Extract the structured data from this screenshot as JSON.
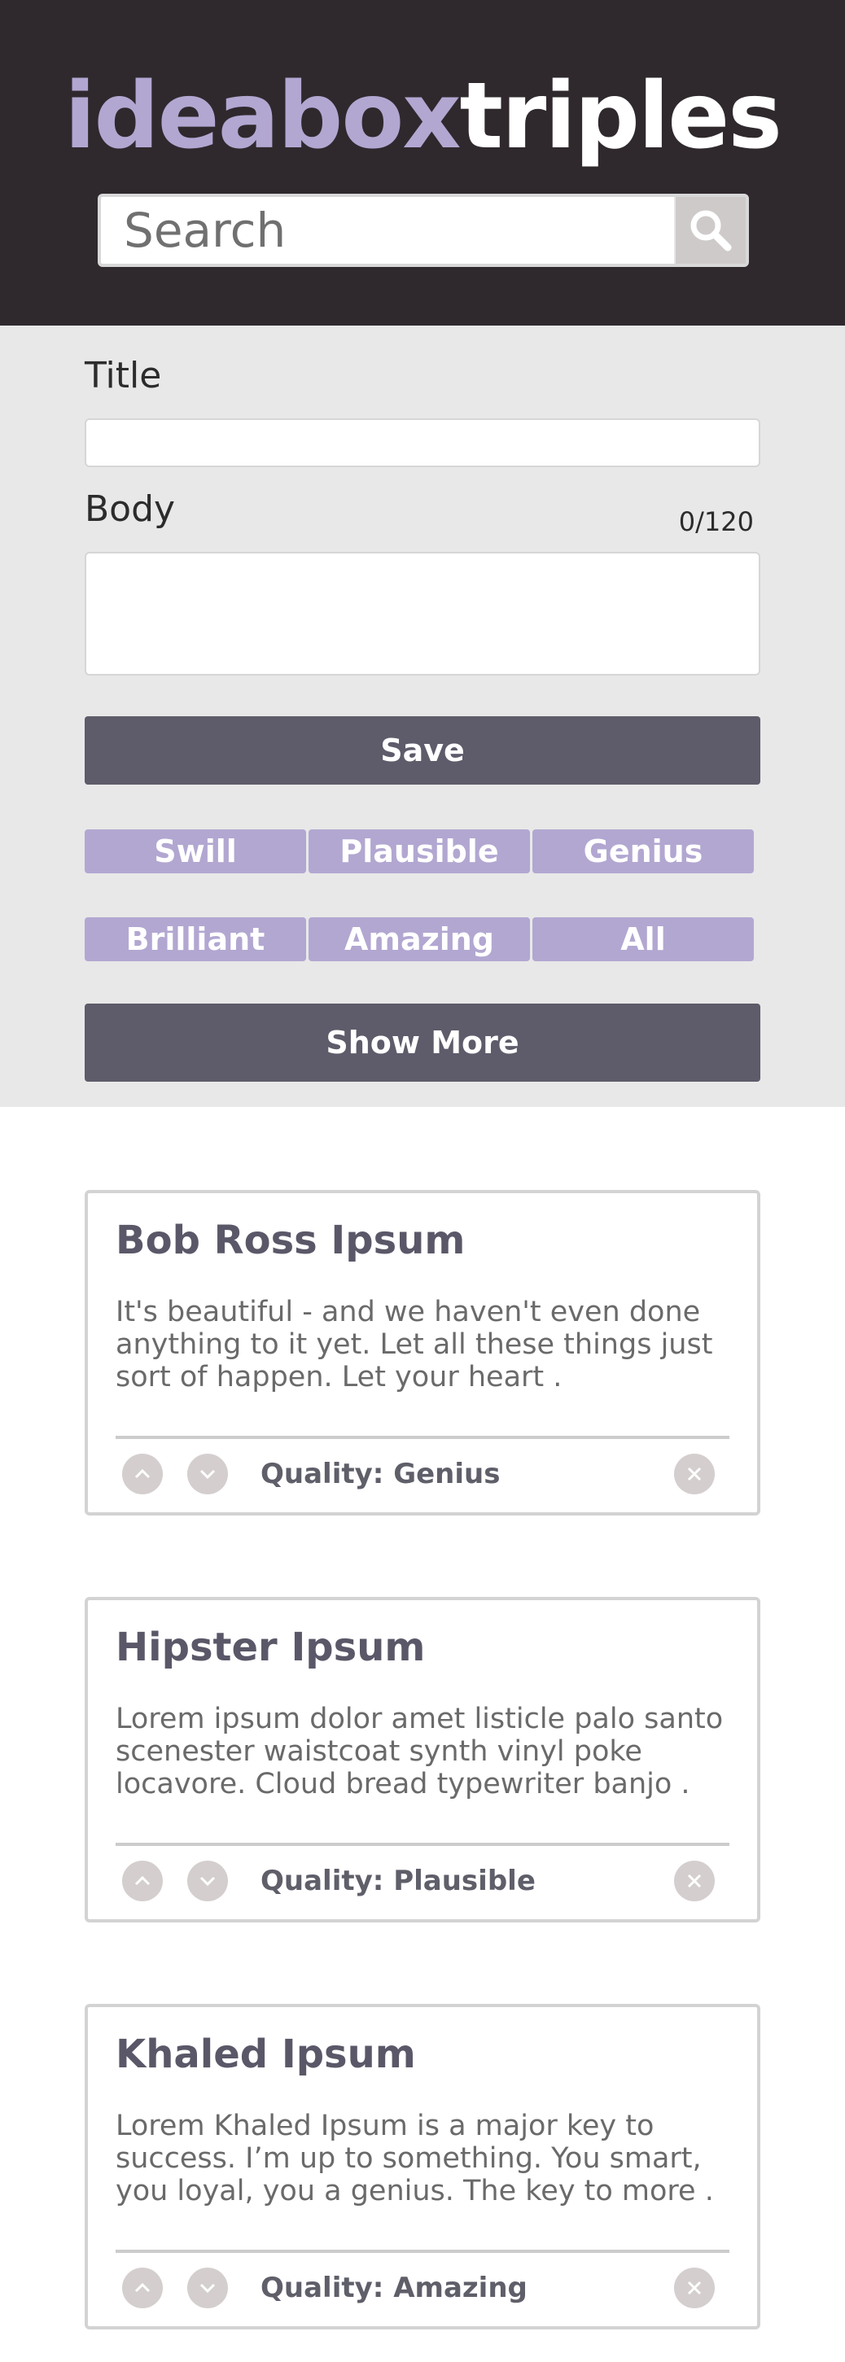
{
  "header": {
    "logo_part1": "ideabox",
    "logo_part2": "triples",
    "search_placeholder": "Search",
    "search_icon": "magnifier-icon"
  },
  "form": {
    "title_label": "Title",
    "body_label": "Body",
    "char_count": "0/120",
    "save_label": "Save",
    "show_more_label": "Show More"
  },
  "filters": [
    "Swill",
    "Plausible",
    "Genius",
    "Brilliant",
    "Amazing",
    "All"
  ],
  "ideas": [
    {
      "title": "Bob Ross Ipsum",
      "body": "It's beautiful - and we haven't even done anything to it yet. Let all these things just sort of happen. Let your heart .",
      "quality": "Quality: Genius"
    },
    {
      "title": "Hipster Ipsum",
      "body": "Lorem ipsum dolor amet listicle palo santo scenester waistcoat synth vinyl poke locavore. Cloud bread typewriter banjo .",
      "quality": "Quality: Plausible"
    },
    {
      "title": "Khaled Ipsum",
      "body": "Lorem Khaled Ipsum is a major key to success. I’m up to something. You smart, you loyal, you a genius. The key to more .",
      "quality": "Quality: Amazing"
    }
  ],
  "colors": {
    "header_bg": "#2f292e",
    "accent_purple": "#b2a7d1",
    "dark_button": "#5e5b6a",
    "form_bg": "#e8e8e8"
  }
}
